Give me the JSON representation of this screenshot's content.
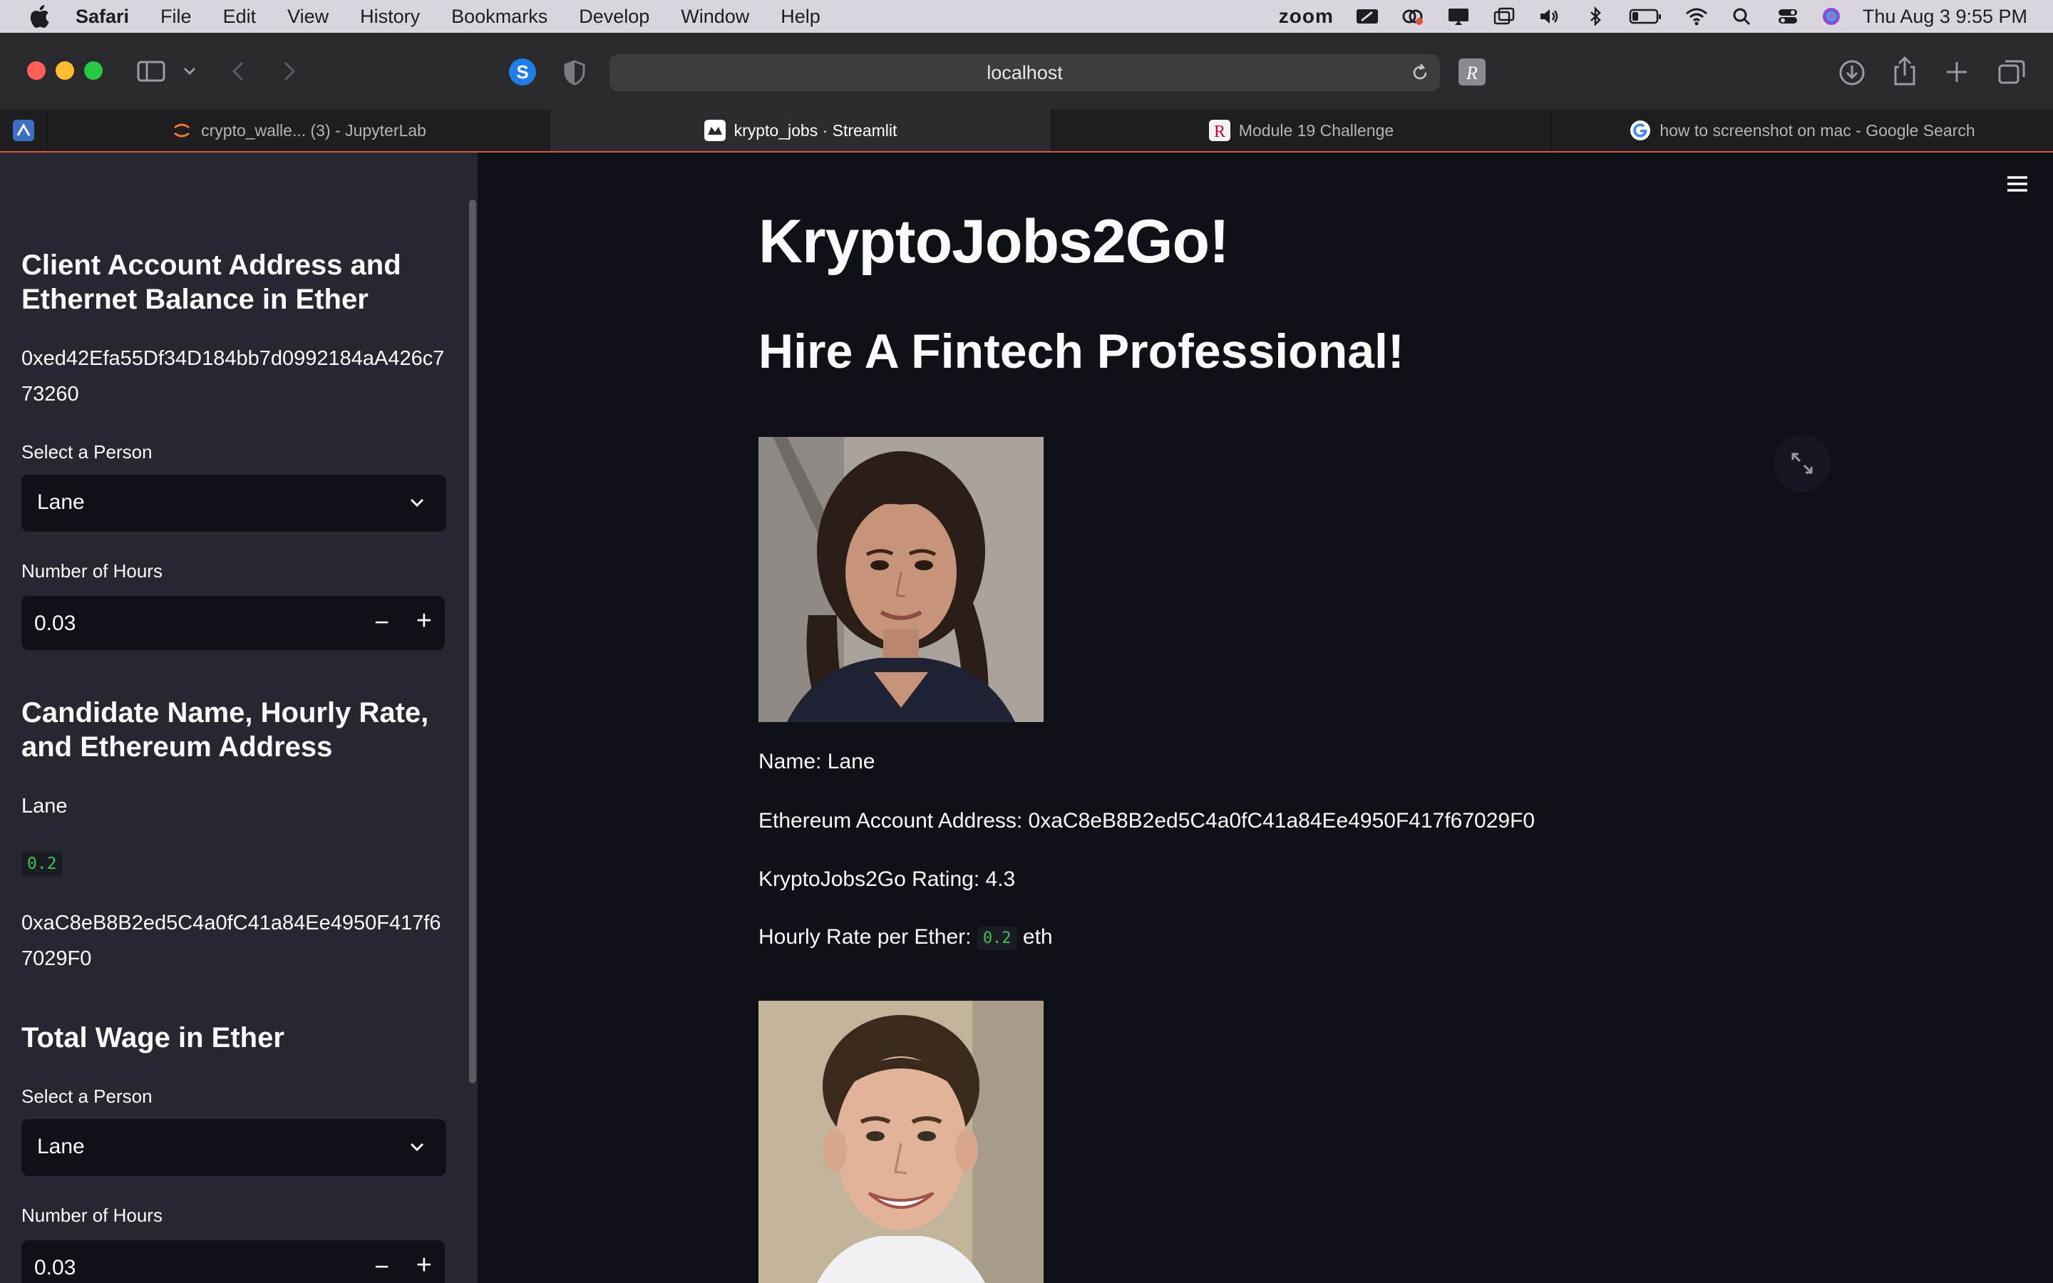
{
  "menubar": {
    "app_name": "Safari",
    "menus": [
      "File",
      "Edit",
      "View",
      "History",
      "Bookmarks",
      "Develop",
      "Window",
      "Help"
    ],
    "zoom_label": "zoom",
    "datetime": "Thu Aug 3  9:55 PM"
  },
  "browser": {
    "address": "localhost",
    "tabs": [
      {
        "label": "crypto_walle... (3) - JupyterLab",
        "active": false
      },
      {
        "label": "krypto_jobs · Streamlit",
        "active": true
      },
      {
        "label": "Module 19 Challenge",
        "active": false
      },
      {
        "label": "how to screenshot on mac - Google Search",
        "active": false
      }
    ]
  },
  "sidebar": {
    "account_heading": "Client Account Address and Ethernet Balance in Ether",
    "account_address": "0xed42Efa55Df34D184bb7d0992184aA426c773260",
    "select_person_label": "Select a Person",
    "select_person_value": "Lane",
    "hours_label": "Number of Hours",
    "hours_value": "0.03",
    "candidate_heading": "Candidate Name, Hourly Rate, and Ethereum Address",
    "candidate_name": "Lane",
    "candidate_rate": "0.2",
    "candidate_address": "0xaC8eB8B2ed5C4a0fC41a84Ee4950F417f67029F0",
    "wage_heading": "Total Wage in Ether",
    "wage_select_label": "Select a Person",
    "wage_select_value": "Lane",
    "wage_hours_label": "Number of Hours",
    "wage_hours_value": "0.03",
    "minus_symbol": "−",
    "plus_symbol": "+"
  },
  "main": {
    "title": "KryptoJobs2Go!",
    "subtitle": "Hire A Fintech Professional!",
    "candidate": {
      "name_line": "Name: Lane",
      "address_line": "Ethereum Account Address: 0xaC8eB8B2ed5C4a0fC41a84Ee4950F417f67029F0",
      "rating_line": "KryptoJobs2Go Rating: 4.3",
      "rate_prefix": "Hourly Rate per Ether:",
      "rate_value": "0.2",
      "rate_suffix": "eth"
    }
  },
  "colors": {
    "app_bg": "#0e1117",
    "sidebar_bg": "#262730",
    "code_green": "#40c057",
    "tab_accent": "#e2533c"
  }
}
